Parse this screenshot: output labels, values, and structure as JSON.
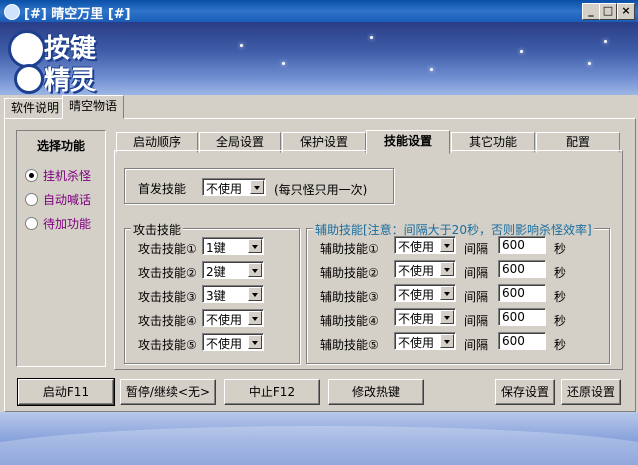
{
  "window": {
    "title": "[#] 晴空万里 [#]",
    "minimize": "_",
    "restore": "□",
    "close": "×"
  },
  "logo": {
    "line1": "按键",
    "line2": "精灵"
  },
  "top_tabs": [
    {
      "label": "软件说明",
      "active": false
    },
    {
      "label": "晴空物语",
      "active": true
    }
  ],
  "left_panel": {
    "title": "选择功能",
    "options": [
      {
        "label": "挂机杀怪",
        "selected": true
      },
      {
        "label": "自动喊话",
        "selected": false
      },
      {
        "label": "待加功能",
        "selected": false
      }
    ]
  },
  "sub_tabs": [
    {
      "label": "启动顺序",
      "active": false
    },
    {
      "label": "全局设置",
      "active": false
    },
    {
      "label": "保护设置",
      "active": false
    },
    {
      "label": "技能设置",
      "active": true
    },
    {
      "label": "其它功能",
      "active": false
    },
    {
      "label": "配置",
      "active": false
    }
  ],
  "first_skill": {
    "label": "首发技能",
    "value": "不使用",
    "note": "(每只怪只用一次)"
  },
  "attack": {
    "title": "攻击技能",
    "rows": [
      {
        "label": "攻击技能①",
        "value": "1键"
      },
      {
        "label": "攻击技能②",
        "value": "2键"
      },
      {
        "label": "攻击技能③",
        "value": "3键"
      },
      {
        "label": "攻击技能④",
        "value": "不使用"
      },
      {
        "label": "攻击技能⑤",
        "value": "不使用"
      }
    ]
  },
  "aux": {
    "title": "辅助技能[注意：间隔大于20秒，否则影响杀怪效率]",
    "interval_label": "间隔",
    "unit": "秒",
    "rows": [
      {
        "label": "辅助技能①",
        "value": "不使用",
        "interval": "600"
      },
      {
        "label": "辅助技能②",
        "value": "不使用",
        "interval": "600"
      },
      {
        "label": "辅助技能③",
        "value": "不使用",
        "interval": "600"
      },
      {
        "label": "辅助技能④",
        "value": "不使用",
        "interval": "600"
      },
      {
        "label": "辅助技能⑤",
        "value": "不使用",
        "interval": "600"
      }
    ]
  },
  "buttons": {
    "start": "启动F11",
    "pause": "暂停/继续<无>",
    "stop": "中止F12",
    "hotkey": "修改热键",
    "save": "保存设置",
    "restore": "还原设置"
  },
  "colors": {
    "title_bar": "#0a4fa8",
    "face": "#d4d0c8",
    "purple_text": "#800080",
    "aux_title": "#1a6ea0"
  }
}
